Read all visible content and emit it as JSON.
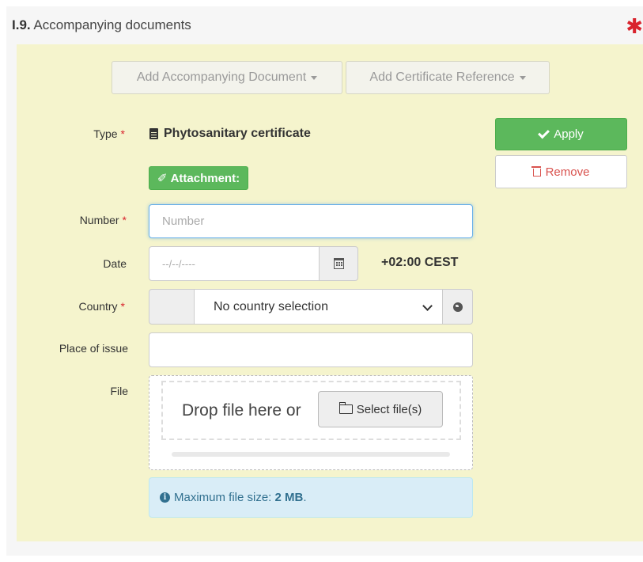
{
  "section": {
    "number": "I.9.",
    "title": "Accompanying documents",
    "required_mark": "✱"
  },
  "toolbar": {
    "add_document_label": "Add Accompanying Document",
    "add_certificate_label": "Add Certificate Reference"
  },
  "form": {
    "type_label": "Type",
    "type_value": "Phytosanitary certificate",
    "attachment_badge": "Attachment:",
    "number_label": "Number",
    "number_placeholder": "Number",
    "number_value": "",
    "date_label": "Date",
    "date_placeholder": "--/--/----",
    "timezone": "+02:00 CEST",
    "country_label": "Country",
    "country_selected": "No country selection",
    "place_label": "Place of issue",
    "place_value": "",
    "file_label": "File",
    "drop_text": "Drop file here or",
    "select_file_label": "Select file(s)",
    "required_marker": "*"
  },
  "actions": {
    "apply_label": "Apply",
    "remove_label": "Remove"
  },
  "info": {
    "prefix": "Maximum file size: ",
    "size": "2 MB",
    "suffix": "."
  },
  "colors": {
    "panel_bg": "#f5f4cd",
    "success": "#5cb85c",
    "danger": "#d9534f",
    "required": "#d9232d",
    "info_bg": "#d9edf7"
  }
}
